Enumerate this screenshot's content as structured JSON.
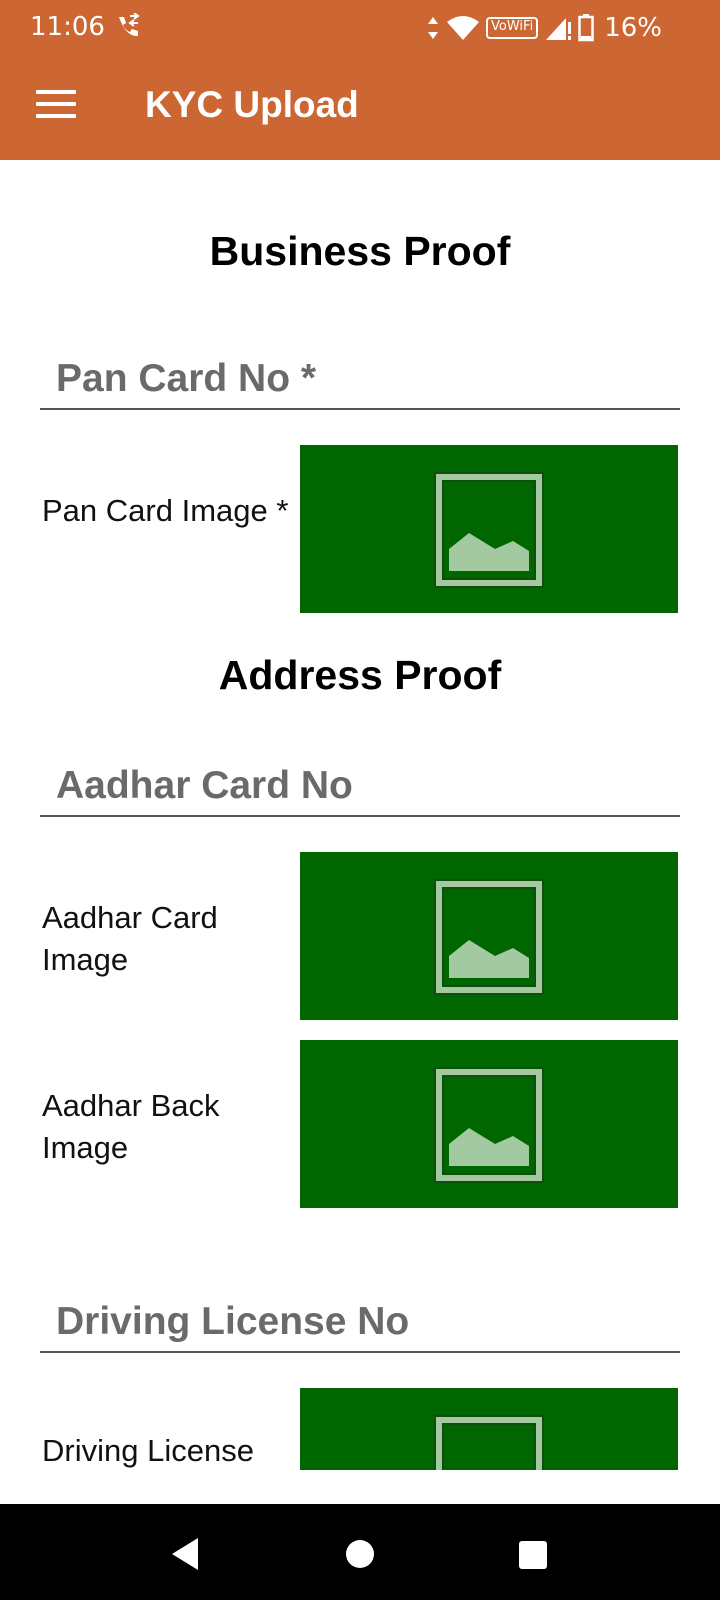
{
  "colors": {
    "accent": "#cc6633",
    "image_placeholder_bg": "#006600",
    "image_icon": "#a3c9a0"
  },
  "status_bar": {
    "time": "11:06",
    "network_badge": "VoWiFi",
    "battery": "16%"
  },
  "app_bar": {
    "title": "KYC Upload",
    "menu_icon": "hamburger-menu-icon"
  },
  "business_proof": {
    "title": "Business Proof",
    "pan_card_no_placeholder": "Pan Card No *",
    "pan_card_image_label": "Pan Card Image *"
  },
  "address_proof": {
    "title": "Address Proof",
    "aadhar_card_no_placeholder": "Aadhar Card No",
    "aadhar_card_image_label": "Aadhar Card Image",
    "aadhar_back_image_label": "Aadhar Back Image",
    "driving_license_no_placeholder": "Driving License No",
    "driving_license_label": "Driving License"
  },
  "nav_bar": {
    "back_icon": "back-triangle-icon",
    "home_icon": "home-circle-icon",
    "recents_icon": "recents-square-icon"
  }
}
